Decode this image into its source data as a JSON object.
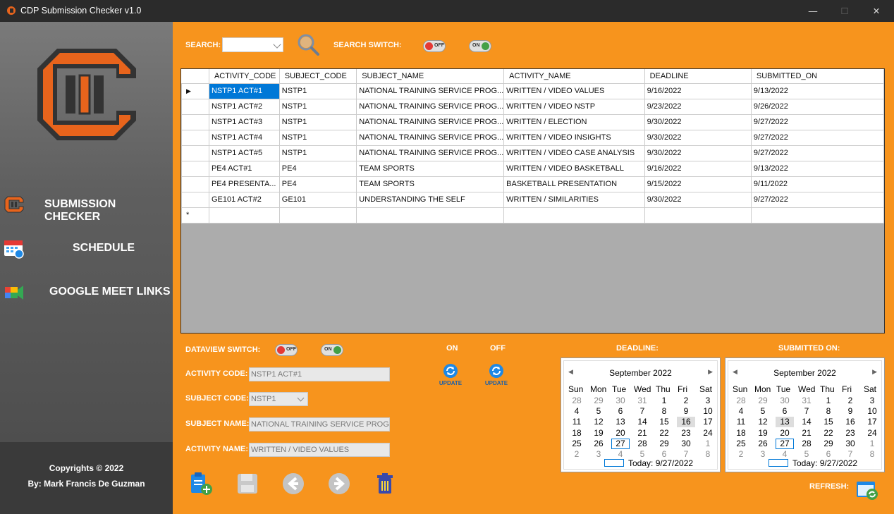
{
  "window": {
    "title": "CDP Submission Checker v1.0",
    "minimize": "—",
    "maximize": "☐",
    "close": "✕"
  },
  "sidebar": {
    "items": [
      {
        "label": "SUBMISSION CHECKER",
        "icon": "cdp-logo-icon"
      },
      {
        "label": "SCHEDULE",
        "icon": "calendar-icon"
      },
      {
        "label": "GOOGLE MEET LINKS",
        "icon": "google-meet-icon"
      }
    ],
    "copyright": "Copyrights © 2022",
    "author": "By: Mark Francis De Guzman"
  },
  "search": {
    "label": "SEARCH:",
    "value": "",
    "switch_label": "SEARCH SWITCH:",
    "off_text": "OFF",
    "on_text": "ON"
  },
  "grid": {
    "columns": [
      "ACTIVITY_CODE",
      "SUBJECT_CODE",
      "SUBJECT_NAME",
      "ACTIVITY_NAME",
      "DEADLINE",
      "SUBMITTED_ON"
    ],
    "rows": [
      [
        "NSTP1 ACT#1",
        "NSTP1",
        "NATIONAL TRAINING SERVICE PROG...",
        "WRITTEN / VIDEO VALUES",
        "9/16/2022",
        "9/13/2022"
      ],
      [
        "NSTP1 ACT#2",
        "NSTP1",
        "NATIONAL TRAINING SERVICE PROG...",
        "WRITTEN / VIDEO NSTP",
        "9/23/2022",
        "9/26/2022"
      ],
      [
        "NSTP1 ACT#3",
        "NSTP1",
        "NATIONAL TRAINING SERVICE PROG...",
        "WRITTEN / ELECTION",
        "9/30/2022",
        "9/27/2022"
      ],
      [
        "NSTP1 ACT#4",
        "NSTP1",
        "NATIONAL TRAINING SERVICE PROG...",
        "WRITTEN / VIDEO INSIGHTS",
        "9/30/2022",
        "9/27/2022"
      ],
      [
        "NSTP1 ACT#5",
        "NSTP1",
        "NATIONAL TRAINING SERVICE PROG...",
        "WRITTEN / VIDEO CASE ANALYSIS",
        "9/30/2022",
        "9/27/2022"
      ],
      [
        "PE4 ACT#1",
        "PE4",
        "TEAM SPORTS",
        "WRITTEN / VIDEO BASKETBALL",
        "9/16/2022",
        "9/13/2022"
      ],
      [
        "PE4 PRESENTA...",
        "PE4",
        "TEAM SPORTS",
        "BASKETBALL PRESENTATION",
        "9/15/2022",
        "9/11/2022"
      ],
      [
        "GE101 ACT#2",
        "GE101",
        "UNDERSTANDING THE SELF",
        "WRITTEN / SIMILARITIES",
        "9/30/2022",
        "9/27/2022"
      ]
    ],
    "current_row_marker": "▶",
    "new_row_marker": "*"
  },
  "form": {
    "dataview_label": "DATAVIEW SWITCH:",
    "off_text": "OFF",
    "on_text": "ON",
    "activity_code_label": "ACTIVITY CODE:",
    "activity_code_value": "NSTP1 ACT#1",
    "subject_code_label": "SUBJECT CODE:",
    "subject_code_value": "NSTP1",
    "subject_name_label": "SUBJECT NAME:",
    "subject_name_value": "NATIONAL TRAINING SERVICE PROGRAM",
    "activity_name_label": "ACTIVITY NAME:",
    "activity_name_value": "WRITTEN / VIDEO VALUES",
    "update_on_label": "ON",
    "update_off_label": "OFF",
    "update_text": "UPDATE",
    "deadline_label": "DEADLINE:",
    "submitted_label": "SUBMITTED ON:",
    "refresh_label": "REFRESH:"
  },
  "calendars": {
    "month": "September 2022",
    "dow": [
      "Sun",
      "Mon",
      "Tue",
      "Wed",
      "Thu",
      "Fri",
      "Sat"
    ],
    "days": [
      [
        "28",
        "29",
        "30",
        "31",
        "1",
        "2",
        "3"
      ],
      [
        "4",
        "5",
        "6",
        "7",
        "8",
        "9",
        "10"
      ],
      [
        "11",
        "12",
        "13",
        "14",
        "15",
        "16",
        "17"
      ],
      [
        "18",
        "19",
        "20",
        "21",
        "22",
        "23",
        "24"
      ],
      [
        "25",
        "26",
        "27",
        "28",
        "29",
        "30",
        "1"
      ],
      [
        "2",
        "3",
        "4",
        "5",
        "6",
        "7",
        "8"
      ]
    ],
    "today_text": "Today: 9/27/2022",
    "deadline_selected": "16",
    "submitted_selected": "13"
  },
  "colors": {
    "accent": "#f7941d",
    "sidebar": "#5f5f5f",
    "selection": "#0078d7"
  }
}
